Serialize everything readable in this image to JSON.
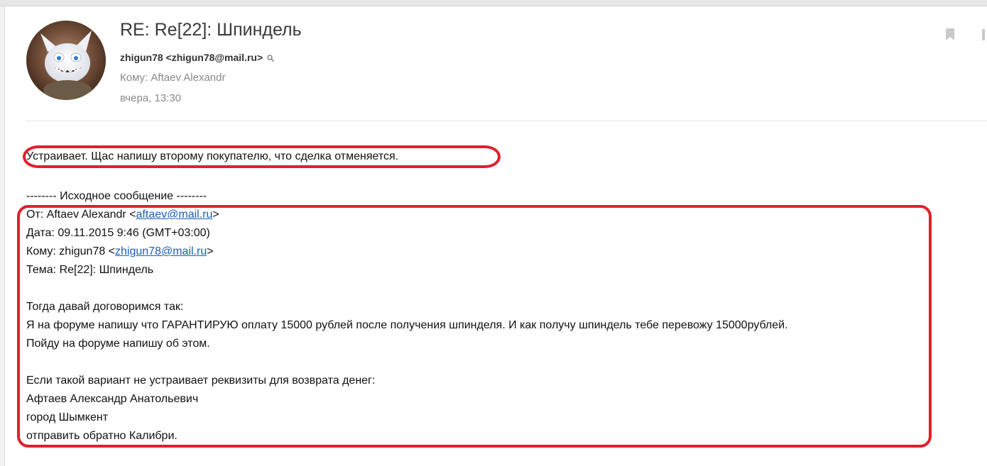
{
  "message": {
    "subject": "RE: Re[22]: Шпиндель",
    "sender": "zhigun78 <zhigun78@mail.ru>",
    "to": "Кому: Aftaev Alexandr",
    "date": "вчера, 13:30"
  },
  "body": {
    "reply_text": "Устраивает. Щас напишу второму покупателю, что сделка отменяется.",
    "quote_header": "-------- Исходное сообщение --------",
    "from_prefix": "От: Aftaev Alexandr <",
    "from_email": "aftaev@mail.ru",
    "from_suffix": ">",
    "date": "Дата: 09.11.2015 9:46 (GMT+03:00)",
    "to_prefix": "Кому: zhigun78 <",
    "to_email": "zhigun78@mail.ru",
    "to_suffix": ">",
    "subject": "Тема: Re[22]: Шпиндель",
    "line1": "Тогда давай договоримся так:",
    "line2": "Я на форуме напишу что ГАРАНТИРУЮ оплату 15000 рублей после получения шпинделя. И как получу шпиндель тебе перевожу 15000рублей.",
    "line3": "Пойду на форуме напишу об этом.",
    "line4": "Если такой вариант не устраивает реквизиты для возврата денег:",
    "line5": "Афтаев Александр Анатольевич",
    "line6": "город Шымкент",
    "line7": "отправить обратно Калибри."
  },
  "icons": {
    "bookmark": "bookmark-icon",
    "more": "more-icon",
    "magnifier": "magnifier-icon",
    "avatar": "avatar-creature"
  },
  "colors": {
    "annotation_red": "#e0202e",
    "link": "#1a5fb4",
    "meta_gray": "#8a8a8a"
  }
}
